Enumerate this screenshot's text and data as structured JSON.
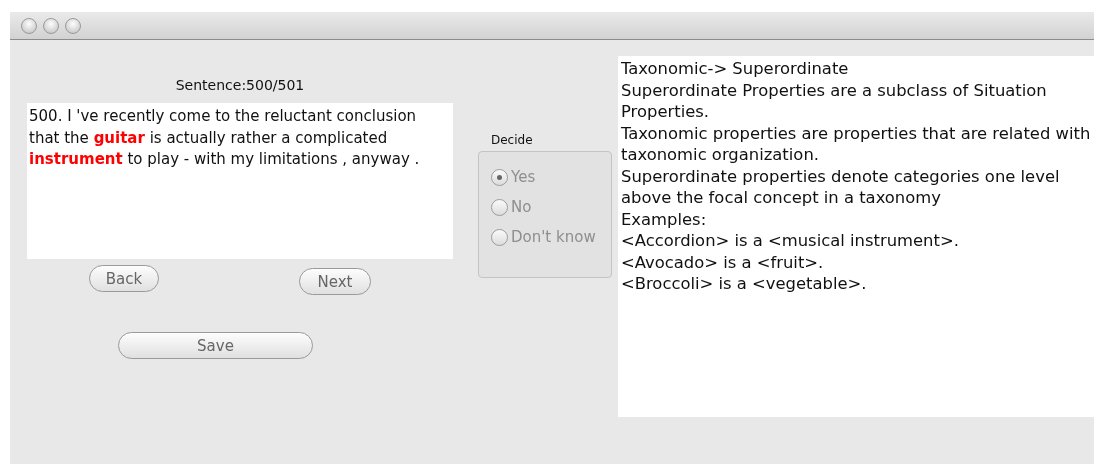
{
  "sentence_counter": "Sentence:500/501",
  "sentence": "500. I 've recently come to the reluctant conclusion that the **guitar** is actually rather a complicated **instrument** to play - with my limitations , anyway .",
  "decide": {
    "label": "Decide",
    "disabled": true,
    "options": [
      {
        "label": "Yes",
        "selected": true
      },
      {
        "label": "No",
        "selected": false
      },
      {
        "label": "Don't know",
        "selected": false
      }
    ]
  },
  "buttons": [
    {
      "kind": "back",
      "label": "Back"
    },
    {
      "kind": "next",
      "label": "Next"
    },
    {
      "kind": "save",
      "label": "Save"
    }
  ],
  "description": [
    "Taxonomic-> Superordinate",
    "Superordinate Properties are a subclass of Situation Properties.",
    "Taxonomic properties are properties that are related with taxonomic organization.",
    "Superordinate properties denote categories one level above the focal concept in a taxonomy",
    "Examples:",
    "<Accordion> is a <musical instrument>.",
    "<Avocado> is a <fruit>.",
    "<Broccoli> is a <vegetable>."
  ]
}
